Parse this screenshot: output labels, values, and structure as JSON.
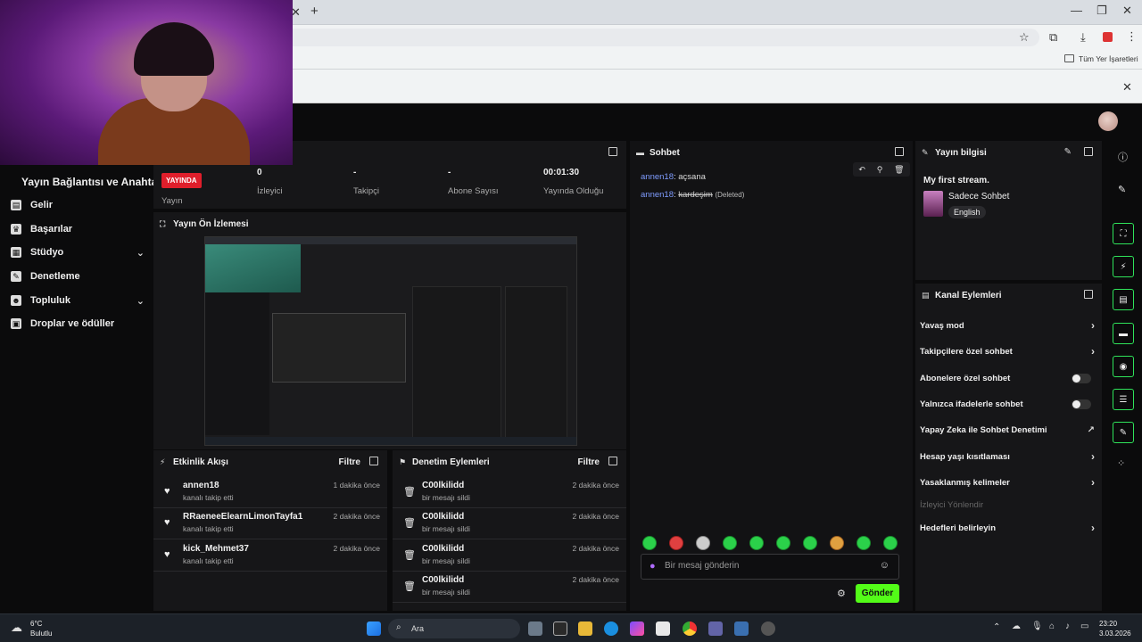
{
  "browser": {
    "new_tab": "+",
    "bookmark_all": "Tüm Yer İşaretleri"
  },
  "sidebar": {
    "title": "Yayın Bağlantısı ve Anahtarı",
    "items": [
      {
        "label": "Gelir",
        "icon": "money-icon",
        "expandable": false
      },
      {
        "label": "Başarılar",
        "icon": "trophy-icon",
        "expandable": false
      },
      {
        "label": "Stüdyo",
        "icon": "studio-icon",
        "expandable": true
      },
      {
        "label": "Denetleme",
        "icon": "wrench-icon",
        "expandable": false
      },
      {
        "label": "Topluluk",
        "icon": "community-icon",
        "expandable": true
      },
      {
        "label": "Droplar ve ödüller",
        "icon": "gift-icon",
        "expandable": false
      }
    ]
  },
  "stats": {
    "live_badge": "YAYINDA",
    "live_label": "Yayın",
    "viewers_value": "0",
    "viewers_label": "İzleyici",
    "followers_value": "-",
    "followers_label": "Takipçi",
    "subs_value": "-",
    "subs_label": "Abone Sayısı",
    "uptime_value": "00:01:30",
    "uptime_label": "Yayında Olduğu"
  },
  "preview": {
    "title": "Yayın Ön İzlemesi"
  },
  "activity": {
    "title": "Etkinlik Akışı",
    "filter": "Filtre",
    "rows": [
      {
        "name": "annen18",
        "sub": "kanalı takip etti",
        "time": "1 dakika önce"
      },
      {
        "name": "RRaeneeElearnLimonTayfa1",
        "sub": "kanalı takip etti",
        "time": "2 dakika önce"
      },
      {
        "name": "kick_Mehmet37",
        "sub": "kanalı takip etti",
        "time": "2 dakika önce"
      }
    ]
  },
  "modactions": {
    "title": "Denetim Eylemleri",
    "filter": "Filtre",
    "rows": [
      {
        "name": "C00lkilidd",
        "sub": "bir mesajı sildi",
        "time": "2 dakika önce"
      },
      {
        "name": "C00lkilidd",
        "sub": "bir mesajı sildi",
        "time": "2 dakika önce"
      },
      {
        "name": "C00lkilidd",
        "sub": "bir mesajı sildi",
        "time": "2 dakika önce"
      },
      {
        "name": "C00lkilidd",
        "sub": "bir mesajı sildi",
        "time": "2 dakika önce"
      }
    ]
  },
  "chat": {
    "title": "Sohbet",
    "messages": [
      {
        "user": "annen18",
        "text": "açsana",
        "deleted": false
      },
      {
        "user": "annen18",
        "text": "kardeşim",
        "deleted": true,
        "tag": "(Deleted)"
      }
    ],
    "placeholder": "Bir mesaj gönderin",
    "send": "Gönder"
  },
  "stream_info": {
    "title": "Yayın bilgisi",
    "stream_title": "My first stream.",
    "category": "Sadece Sohbet",
    "language": "English"
  },
  "channel_actions": {
    "title": "Kanal Eylemleri",
    "items": [
      {
        "label": "Yavaş mod",
        "control": "chevron"
      },
      {
        "label": "Takipçilere özel sohbet",
        "control": "chevron"
      },
      {
        "label": "Abonelere özel sohbet",
        "control": "toggle"
      },
      {
        "label": "Yalnızca ifadelerle sohbet",
        "control": "toggle"
      },
      {
        "label": "Yapay Zeka ile Sohbet Denetimi",
        "control": "external"
      },
      {
        "label": "Hesap yaşı kısıtlaması",
        "control": "chevron"
      },
      {
        "label": "Yasaklanmış kelimeler",
        "control": "chevron"
      },
      {
        "label": "İzleyici Yönlendir",
        "control": "none",
        "disabled": true
      },
      {
        "label": "Hedefleri belirleyin",
        "control": "chevron"
      }
    ]
  },
  "taskbar": {
    "weather_temp": "6°C",
    "weather_desc": "Bulutlu",
    "search": "Ara",
    "time": "23:20",
    "date": "3.03.2026"
  },
  "colors": {
    "accent": "#53fc18",
    "live": "#e01e2b",
    "username": "#7f9cff"
  }
}
